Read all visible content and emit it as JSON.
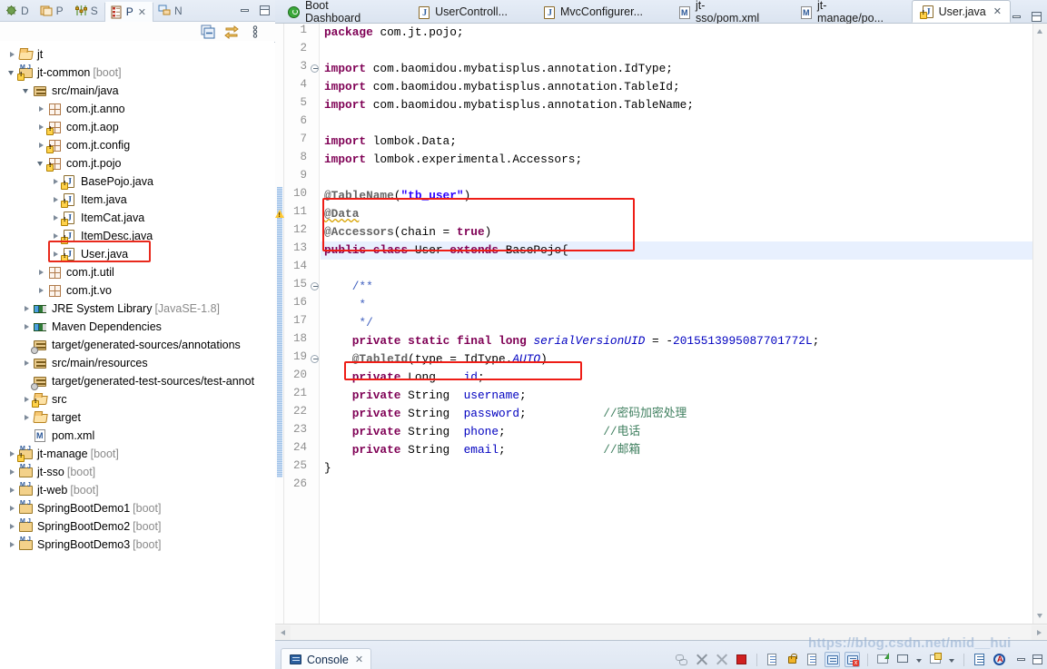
{
  "view_tabs": [
    {
      "label": "D",
      "icon": "debug-icon",
      "active": false
    },
    {
      "label": "P",
      "icon": "project-explorer-icon",
      "active": false
    },
    {
      "label": "S",
      "icon": "servers-icon",
      "active": false
    },
    {
      "label": "P",
      "icon": "package-explorer-icon",
      "active": true,
      "close": "✕"
    },
    {
      "label": "N",
      "icon": "navigator-icon",
      "active": false
    }
  ],
  "view_toolbar": [
    {
      "name": "collapse-all-icon"
    },
    {
      "name": "link-with-editor-icon"
    },
    {
      "name": "view-menu-icon"
    }
  ],
  "window_buttons": {
    "minimize": "minimize-icon",
    "maximize": "maximize-icon"
  },
  "tree": [
    {
      "indent": 0,
      "arrow": "collapsed",
      "icon": "folder-open",
      "label": "jt",
      "suffix": ""
    },
    {
      "indent": 0,
      "arrow": "expanded",
      "icon": "project-warn",
      "label": "jt-common",
      "suffix": " [boot]"
    },
    {
      "indent": 1,
      "arrow": "expanded",
      "icon": "source-folder",
      "label": "src/main/java",
      "suffix": ""
    },
    {
      "indent": 2,
      "arrow": "collapsed",
      "icon": "package",
      "label": "com.jt.anno",
      "suffix": ""
    },
    {
      "indent": 2,
      "arrow": "collapsed",
      "icon": "package-warn",
      "label": "com.jt.aop",
      "suffix": ""
    },
    {
      "indent": 2,
      "arrow": "collapsed",
      "icon": "package-warn",
      "label": "com.jt.config",
      "suffix": ""
    },
    {
      "indent": 2,
      "arrow": "expanded",
      "icon": "package-warn",
      "label": "com.jt.pojo",
      "suffix": ""
    },
    {
      "indent": 3,
      "arrow": "collapsed",
      "icon": "java-warn",
      "label": "BasePojo.java",
      "suffix": ""
    },
    {
      "indent": 3,
      "arrow": "collapsed",
      "icon": "java-warn",
      "label": "Item.java",
      "suffix": ""
    },
    {
      "indent": 3,
      "arrow": "collapsed",
      "icon": "java-warn",
      "label": "ItemCat.java",
      "suffix": ""
    },
    {
      "indent": 3,
      "arrow": "collapsed",
      "icon": "java-warn",
      "label": "ItemDesc.java",
      "suffix": ""
    },
    {
      "indent": 3,
      "arrow": "collapsed",
      "icon": "java-warn",
      "label": "User.java",
      "suffix": "",
      "highlight": true
    },
    {
      "indent": 2,
      "arrow": "collapsed",
      "icon": "package",
      "label": "com.jt.util",
      "suffix": ""
    },
    {
      "indent": 2,
      "arrow": "collapsed",
      "icon": "package",
      "label": "com.jt.vo",
      "suffix": ""
    },
    {
      "indent": 1,
      "arrow": "collapsed",
      "icon": "library",
      "label": "JRE System Library",
      "suffix": " [JavaSE-1.8]"
    },
    {
      "indent": 1,
      "arrow": "collapsed",
      "icon": "library",
      "label": "Maven Dependencies",
      "suffix": ""
    },
    {
      "indent": 1,
      "arrow": "none",
      "icon": "source-folder-gear",
      "label": "target/generated-sources/annotations",
      "suffix": ""
    },
    {
      "indent": 1,
      "arrow": "collapsed",
      "icon": "source-folder",
      "label": "src/main/resources",
      "suffix": ""
    },
    {
      "indent": 1,
      "arrow": "none",
      "icon": "source-folder-gear",
      "label": "target/generated-test-sources/test-annot",
      "suffix": ""
    },
    {
      "indent": 1,
      "arrow": "collapsed",
      "icon": "folder-warn",
      "label": "src",
      "suffix": ""
    },
    {
      "indent": 1,
      "arrow": "collapsed",
      "icon": "folder-open",
      "label": "target",
      "suffix": ""
    },
    {
      "indent": 1,
      "arrow": "none",
      "icon": "xml-file",
      "label": "pom.xml",
      "suffix": ""
    },
    {
      "indent": 0,
      "arrow": "collapsed",
      "icon": "project-warn",
      "label": "jt-manage",
      "suffix": " [boot]"
    },
    {
      "indent": 0,
      "arrow": "collapsed",
      "icon": "project",
      "label": "jt-sso",
      "suffix": " [boot]"
    },
    {
      "indent": 0,
      "arrow": "collapsed",
      "icon": "project",
      "label": "jt-web",
      "suffix": " [boot]"
    },
    {
      "indent": 0,
      "arrow": "collapsed",
      "icon": "project",
      "label": "SpringBootDemo1",
      "suffix": " [boot]"
    },
    {
      "indent": 0,
      "arrow": "collapsed",
      "icon": "project",
      "label": "SpringBootDemo2",
      "suffix": " [boot]"
    },
    {
      "indent": 0,
      "arrow": "collapsed",
      "icon": "project",
      "label": "SpringBootDemo3",
      "suffix": " [boot]"
    }
  ],
  "editor_tabs": [
    {
      "label": "Boot Dashboard",
      "icon": "spring-boot-icon",
      "active": false
    },
    {
      "label": "UserControll...",
      "icon": "java-file-icon",
      "active": false
    },
    {
      "label": "MvcConfigurer...",
      "icon": "java-file-icon",
      "active": false
    },
    {
      "label": "jt-sso/pom.xml",
      "icon": "maven-file-icon",
      "active": false
    },
    {
      "label": "jt-manage/po...",
      "icon": "maven-file-icon",
      "active": false
    },
    {
      "label": "User.java",
      "icon": "java-warn-file-icon",
      "active": true,
      "close": "✕"
    }
  ],
  "code": {
    "first_line": 1,
    "last_line": 26,
    "current_line": 13,
    "warning_line": 11,
    "fold_lines": [
      3,
      15,
      19
    ],
    "change_bar": {
      "from_line": 10,
      "to_line": 25
    },
    "lines": [
      {
        "n": 1,
        "text": "package com.jt.pojo;"
      },
      {
        "n": 2,
        "text": ""
      },
      {
        "n": 3,
        "text": "import com.baomidou.mybatisplus.annotation.IdType;"
      },
      {
        "n": 4,
        "text": "import com.baomidou.mybatisplus.annotation.TableId;"
      },
      {
        "n": 5,
        "text": "import com.baomidou.mybatisplus.annotation.TableName;"
      },
      {
        "n": 6,
        "text": ""
      },
      {
        "n": 7,
        "text": "import lombok.Data;"
      },
      {
        "n": 8,
        "text": "import lombok.experimental.Accessors;"
      },
      {
        "n": 9,
        "text": ""
      },
      {
        "n": 10,
        "text": "@TableName(\"tb_user\")"
      },
      {
        "n": 11,
        "text": "@Data"
      },
      {
        "n": 12,
        "text": "@Accessors(chain = true)"
      },
      {
        "n": 13,
        "text": "public class User extends BasePojo{"
      },
      {
        "n": 14,
        "text": ""
      },
      {
        "n": 15,
        "text": "    /**"
      },
      {
        "n": 16,
        "text": "     *"
      },
      {
        "n": 17,
        "text": "     */"
      },
      {
        "n": 18,
        "text": "    private static final long serialVersionUID = -2015513995087701772L;"
      },
      {
        "n": 19,
        "text": "    @TableId(type = IdType.AUTO)"
      },
      {
        "n": 20,
        "text": "    private Long    id;"
      },
      {
        "n": 21,
        "text": "    private String  username;"
      },
      {
        "n": 22,
        "text": "    private String  password;           //密码加密处理"
      },
      {
        "n": 23,
        "text": "    private String  phone;              //电话"
      },
      {
        "n": 24,
        "text": "    private String  email;              //邮箱"
      },
      {
        "n": 25,
        "text": "}"
      },
      {
        "n": 26,
        "text": ""
      }
    ],
    "annotations": [
      {
        "name": "annotation-box-class",
        "lines": "10-12"
      },
      {
        "name": "annotation-box-tableid",
        "lines": "19"
      }
    ]
  },
  "console": {
    "tab_label": "Console",
    "tab_close": "✕",
    "tools": [
      {
        "name": "link-icon",
        "style": "plain"
      },
      {
        "name": "terminate-icon",
        "style": "plain"
      },
      {
        "name": "remove-all-terminated-icon",
        "style": "plain"
      },
      {
        "name": "stop-icon",
        "style": "plain"
      },
      {
        "name": "separator",
        "style": "sep"
      },
      {
        "name": "clear-console-icon",
        "style": "plain"
      },
      {
        "name": "scroll-lock-icon",
        "style": "plain"
      },
      {
        "name": "word-wrap-icon",
        "style": "plain"
      },
      {
        "name": "show-console-on-output-icon",
        "style": "boxed"
      },
      {
        "name": "show-console-on-error-icon",
        "style": "boxed"
      },
      {
        "name": "separator2",
        "style": "sep"
      },
      {
        "name": "pin-console-icon",
        "style": "plain"
      },
      {
        "name": "display-selected-console-icon",
        "style": "plain"
      },
      {
        "name": "display-console-dropdown-icon",
        "style": "dropdown"
      },
      {
        "name": "open-console-icon",
        "style": "plain"
      },
      {
        "name": "open-console-dropdown-icon",
        "style": "dropdown"
      },
      {
        "name": "separator3",
        "style": "sep"
      },
      {
        "name": "properties-icon",
        "style": "plain"
      },
      {
        "name": "annotation-icon",
        "style": "plain"
      }
    ]
  },
  "watermark": "https://blog.csdn.net/mid__hui",
  "colors": {
    "accent": "#2b5f9e",
    "highlight_red": "#ee1d16",
    "keyword": "#7f0055",
    "string": "#2a00ff",
    "comment": "#3f7f5f",
    "javadoc": "#3f5fbf",
    "field": "#0000c0",
    "annotation": "#646464",
    "current_line_bg": "#e8f0fe"
  }
}
